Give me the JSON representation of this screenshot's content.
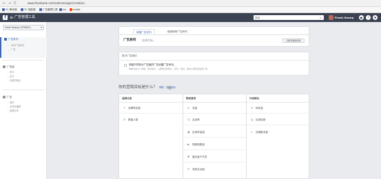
{
  "browser": {
    "back": "←",
    "forward": "→",
    "reload": "C",
    "url": "www.facebook.com/adsmanager/creation",
    "bookmarks": [
      "YC 移动端",
      "YC 电脑端",
      "广告管理工具",
      "ins",
      "reddit"
    ]
  },
  "header": {
    "logo": "f",
    "menu_icon": "≡",
    "title": "广告管理工具",
    "search_placeholder": "搜索",
    "user_name": "Frank Huang",
    "icons": [
      "bell-icon",
      "help-icon",
      "settings-icon"
    ]
  },
  "sidebar": {
    "account": "Frank Huang (1576005...",
    "groups": [
      {
        "label": "广告系列",
        "items": [
          "系列广告系列",
          "广告"
        ]
      },
      {
        "label": "广告组",
        "items": [
          "受众",
          "定位",
          "设置的组合"
        ]
      },
      {
        "label": "广告",
        "items": [
          "格式",
          "素材及编辑",
          "数据分析"
        ]
      }
    ]
  },
  "campaign_card": {
    "tabs": [
      "新建广告系列",
      "使用现有广告系列"
    ],
    "title": "广告系列",
    "subtitle": "选择目标。",
    "button": "切换到快捷创建"
  },
  "split_test_card": {
    "title": "拆分广告测试",
    "checkbox_label": "测量不同拆分广告组的广告创建广告系列。",
    "description": "每种方案以广告组，测试进行，以帮助比较受众、定位、版位、素材从而找到最佳广告"
  },
  "objective": {
    "question": "你的营销目标是什么？",
    "help_link": "帮助：选择目标",
    "help_icon": "?",
    "columns": [
      {
        "title": "品牌认知",
        "options": [
          {
            "icon": "megaphone-icon",
            "glyph": "✎",
            "label": "品牌知名度"
          },
          {
            "icon": "reach-icon",
            "glyph": "✲",
            "label": "覆盖人数"
          }
        ]
      },
      {
        "title": "购买意向",
        "options": [
          {
            "icon": "traffic-icon",
            "glyph": "➤",
            "label": "流量"
          },
          {
            "icon": "engagement-icon",
            "glyph": "☺",
            "label": "互动率"
          },
          {
            "icon": "app-install-icon",
            "glyph": "▣",
            "label": "应用安装量"
          },
          {
            "icon": "video-views-icon",
            "glyph": "▶",
            "label": "视频观看量"
          },
          {
            "icon": "lead-generation-icon",
            "glyph": "▼",
            "label": "潜在客户开发"
          },
          {
            "icon": "messages-icon",
            "glyph": "✉",
            "label": "消息互动量"
          }
        ]
      },
      {
        "title": "行动转化",
        "options": [
          {
            "icon": "conversions-icon",
            "glyph": "⊕",
            "label": "转化量"
          },
          {
            "icon": "catalog-sales-icon",
            "glyph": "▤",
            "label": "目录促销"
          },
          {
            "icon": "store-visits-icon",
            "glyph": "⌂",
            "label": "店铺客流量"
          }
        ]
      }
    ]
  }
}
